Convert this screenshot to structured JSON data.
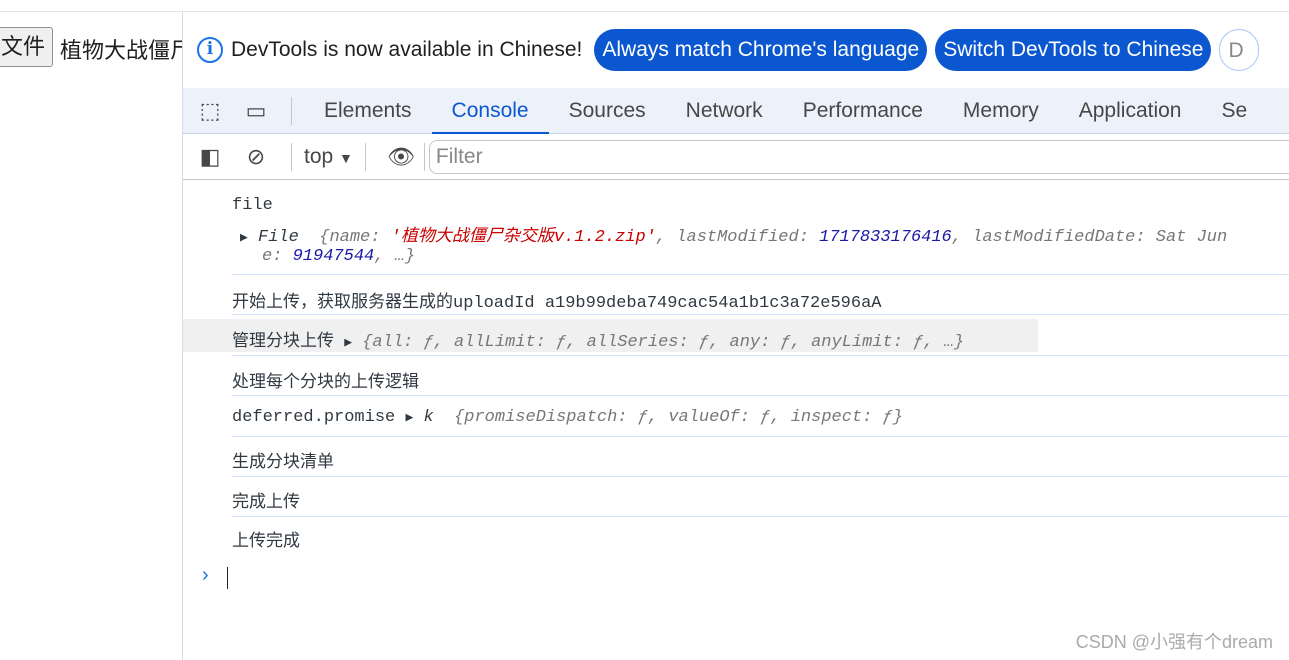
{
  "page": {
    "file_button_label": "文件",
    "file_name": "植物大战僵尸"
  },
  "infobar": {
    "message": "DevTools is now available in Chinese!",
    "btn_match": "Always match Chrome's language",
    "btn_switch": "Switch DevTools to Chinese",
    "btn_dismiss": "D"
  },
  "tabs": [
    "Elements",
    "Console",
    "Sources",
    "Network",
    "Performance",
    "Memory",
    "Application",
    "Se"
  ],
  "active_tab": "Console",
  "toolbar": {
    "context": "top",
    "filter_placeholder": "Filter"
  },
  "logs": {
    "l1_label": "file",
    "l1_type": "File",
    "l1_open": "{name: ",
    "l1_name": "'植物大战僵尸杂交版v.1.2.zip'",
    "l1_lm_key": ", lastModified: ",
    "l1_lm": "1717833176416",
    "l1_lmd": ", lastModifiedDate: Sat Jun",
    "l1_size_key": "e: ",
    "l1_size": "91947544",
    "l1_end": ",  …}",
    "l2": "开始上传，获取服务器生成的uploadId a19b99deba749cac54a1b1c3a72e596aA",
    "l3_label": "管理分块上传",
    "l3_obj": "{all: ƒ, allLimit: ƒ, allSeries: ƒ, any: ƒ, anyLimit: ƒ,  …}",
    "l4": "处理每个分块的上传逻辑",
    "l5_label": "deferred.promise",
    "l5_type": "k",
    "l5_obj": "{promiseDispatch: ƒ, valueOf: ƒ, inspect: ƒ}",
    "l6": "生成分块清单",
    "l7": "完成上传",
    "l8": "上传完成"
  },
  "watermark": "CSDN @小强有个dream",
  "colors": {
    "accent": "#0b57d0",
    "string": "#c80000",
    "number": "#1a1aa6"
  }
}
